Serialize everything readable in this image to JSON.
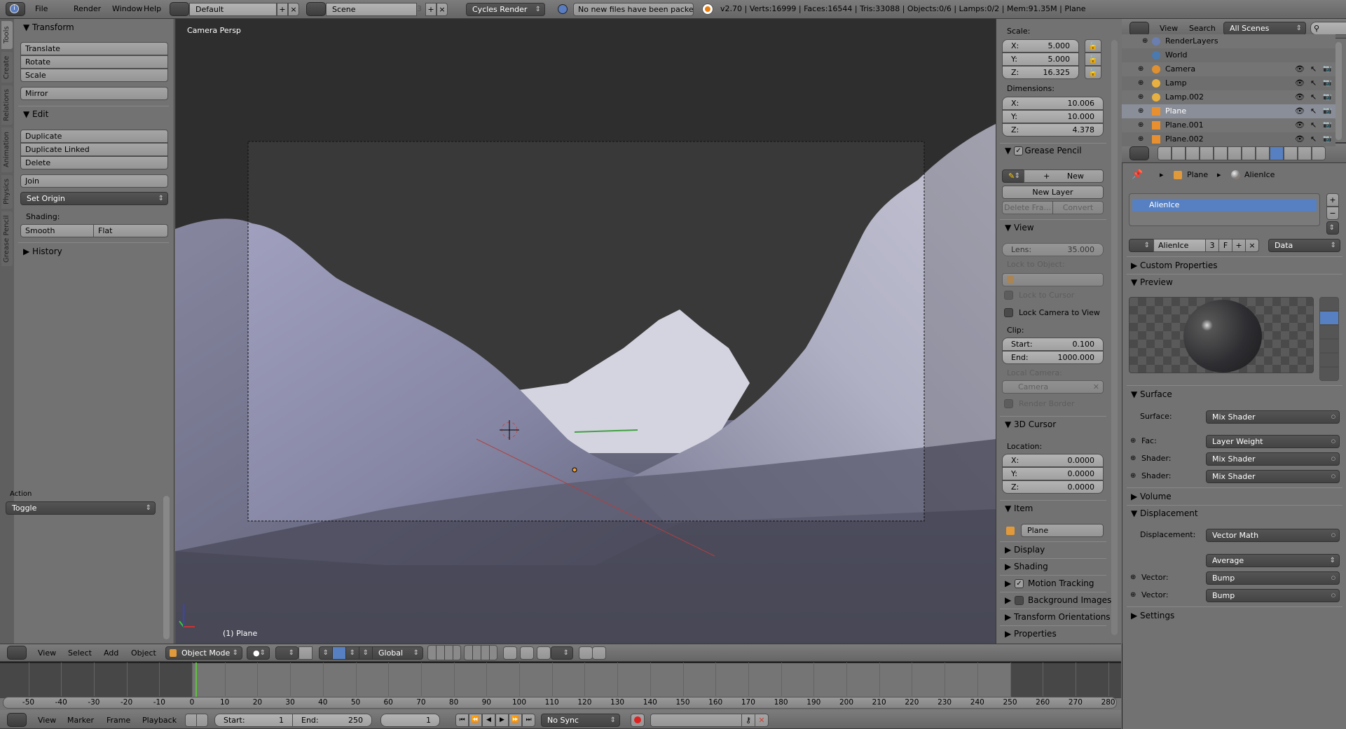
{
  "topbar": {
    "menus": [
      "File",
      "Render",
      "Window",
      "Help"
    ],
    "layout": "Default",
    "scene": "Scene",
    "scene_users": "3",
    "engine": "Cycles Render",
    "report": "No new files have been packed",
    "stats": "v2.70 | Verts:16999 | Faces:16544 | Tris:33088 | Objects:0/6 | Lamps:0/2 | Mem:91.35M | Plane"
  },
  "toolshelf": {
    "tabs": [
      "Tools",
      "Create",
      "Relations",
      "Animation",
      "Physics",
      "Grease Pencil"
    ],
    "transform": {
      "title": "Transform",
      "buttons": [
        "Translate",
        "Rotate",
        "Scale",
        "Mirror"
      ]
    },
    "edit": {
      "title": "Edit",
      "buttons": [
        "Duplicate",
        "Duplicate Linked",
        "Delete",
        "Join"
      ],
      "set_origin": "Set Origin",
      "shading_label": "Shading:",
      "smooth": "Smooth",
      "flat": "Flat"
    },
    "history": "History",
    "action_label": "Action",
    "action_value": "Toggle"
  },
  "viewport": {
    "view_name": "Camera Persp",
    "object_label": "(1) Plane"
  },
  "npanel": {
    "scale_label": "Scale:",
    "scale": [
      {
        "axis": "X:",
        "value": "5.000"
      },
      {
        "axis": "Y:",
        "value": "5.000"
      },
      {
        "axis": "Z:",
        "value": "16.325"
      }
    ],
    "dimensions_label": "Dimensions:",
    "dimensions": [
      {
        "axis": "X:",
        "value": "10.006"
      },
      {
        "axis": "Y:",
        "value": "10.000"
      },
      {
        "axis": "Z:",
        "value": "4.378"
      }
    ],
    "grease_pencil": {
      "title": "Grease Pencil",
      "enabled": true,
      "new": "New",
      "new_layer": "New Layer",
      "delete_frame": "Delete Fra...",
      "convert": "Convert"
    },
    "view": {
      "title": "View",
      "lens_label": "Lens:",
      "lens": "35.000",
      "lock_object": "Lock to Object:",
      "lock_cursor": "Lock to Cursor",
      "lock_camera": "Lock Camera to View",
      "clip": "Clip:",
      "start_label": "Start:",
      "start": "0.100",
      "end_label": "End:",
      "end": "1000.000",
      "local_camera": "Local Camera:",
      "camera": "Camera",
      "render_border": "Render Border"
    },
    "cursor": {
      "title": "3D Cursor",
      "location": "Location:",
      "values": [
        {
          "axis": "X:",
          "value": "0.0000"
        },
        {
          "axis": "Y:",
          "value": "0.0000"
        },
        {
          "axis": "Z:",
          "value": "0.0000"
        }
      ]
    },
    "item": {
      "title": "Item",
      "name": "Plane"
    },
    "collapsed": [
      "Display",
      "Shading",
      "Motion Tracking",
      "Background Images",
      "Transform Orientations",
      "Properties"
    ],
    "motion_tracking_enabled": true,
    "background_images_enabled": false
  },
  "outliner": {
    "menus": [
      "View",
      "Search"
    ],
    "filter": "All Scenes",
    "rows": [
      {
        "name": "RenderLayers",
        "icon": "renderlayers-icon",
        "color": "#6a7fb0"
      },
      {
        "name": "World",
        "icon": "world-icon",
        "color": "#4a7ab0"
      },
      {
        "name": "Camera",
        "icon": "camera-icon",
        "color": "#e09030"
      },
      {
        "name": "Lamp",
        "icon": "lamp-icon",
        "color": "#e8b040"
      },
      {
        "name": "Lamp.002",
        "icon": "lamp-icon",
        "color": "#e8b040"
      },
      {
        "name": "Plane",
        "icon": "mesh-icon",
        "color": "#e89030",
        "selected": true
      },
      {
        "name": "Plane.001",
        "icon": "mesh-icon",
        "color": "#e89030"
      },
      {
        "name": "Plane.002",
        "icon": "mesh-icon",
        "color": "#e89030"
      }
    ]
  },
  "properties": {
    "breadcrumb": [
      "Plane",
      "AlienIce"
    ],
    "slots": [
      "AlienIce"
    ],
    "material": "AlienIce",
    "users": "3",
    "fake": "F",
    "link": "Data",
    "panels": {
      "custom": "Custom Properties",
      "preview": "Preview",
      "surface": "Surface",
      "volume": "Volume",
      "displacement": "Displacement",
      "settings": "Settings"
    },
    "surface_rows": [
      {
        "label": "Surface:",
        "value": "Mix Shader"
      },
      {
        "label": "Fac:",
        "value": "Layer Weight"
      },
      {
        "label": "Shader:",
        "value": "Mix Shader"
      },
      {
        "label": "Shader:",
        "value": "Mix Shader"
      }
    ],
    "displacement_rows": [
      {
        "label": "Displacement:",
        "value": "Vector Math"
      },
      {
        "label": "",
        "value": "Average"
      },
      {
        "label": "Vector:",
        "value": "Bump"
      },
      {
        "label": "Vector:",
        "value": "Bump"
      }
    ]
  },
  "view3d_header": {
    "menus": [
      "View",
      "Select",
      "Add",
      "Object"
    ],
    "mode": "Object Mode",
    "orientation": "Global"
  },
  "timeline": {
    "ticks": [
      -50,
      -40,
      -30,
      -20,
      -10,
      0,
      10,
      20,
      30,
      40,
      50,
      60,
      70,
      80,
      90,
      100,
      110,
      120,
      130,
      140,
      150,
      160,
      170,
      180,
      190,
      200,
      210,
      220,
      230,
      240,
      250,
      260,
      270,
      280
    ],
    "current_frame": 1,
    "range": [
      1,
      250
    ],
    "menus": [
      "View",
      "Marker",
      "Frame",
      "Playback"
    ],
    "start_label": "Start:",
    "start": "1",
    "end_label": "End:",
    "end": "250",
    "frame": "1",
    "sync": "No Sync"
  },
  "colors": {
    "selection": "#5680c2",
    "frame_cursor": "#60c040",
    "terrain": "#9a9ab6"
  }
}
